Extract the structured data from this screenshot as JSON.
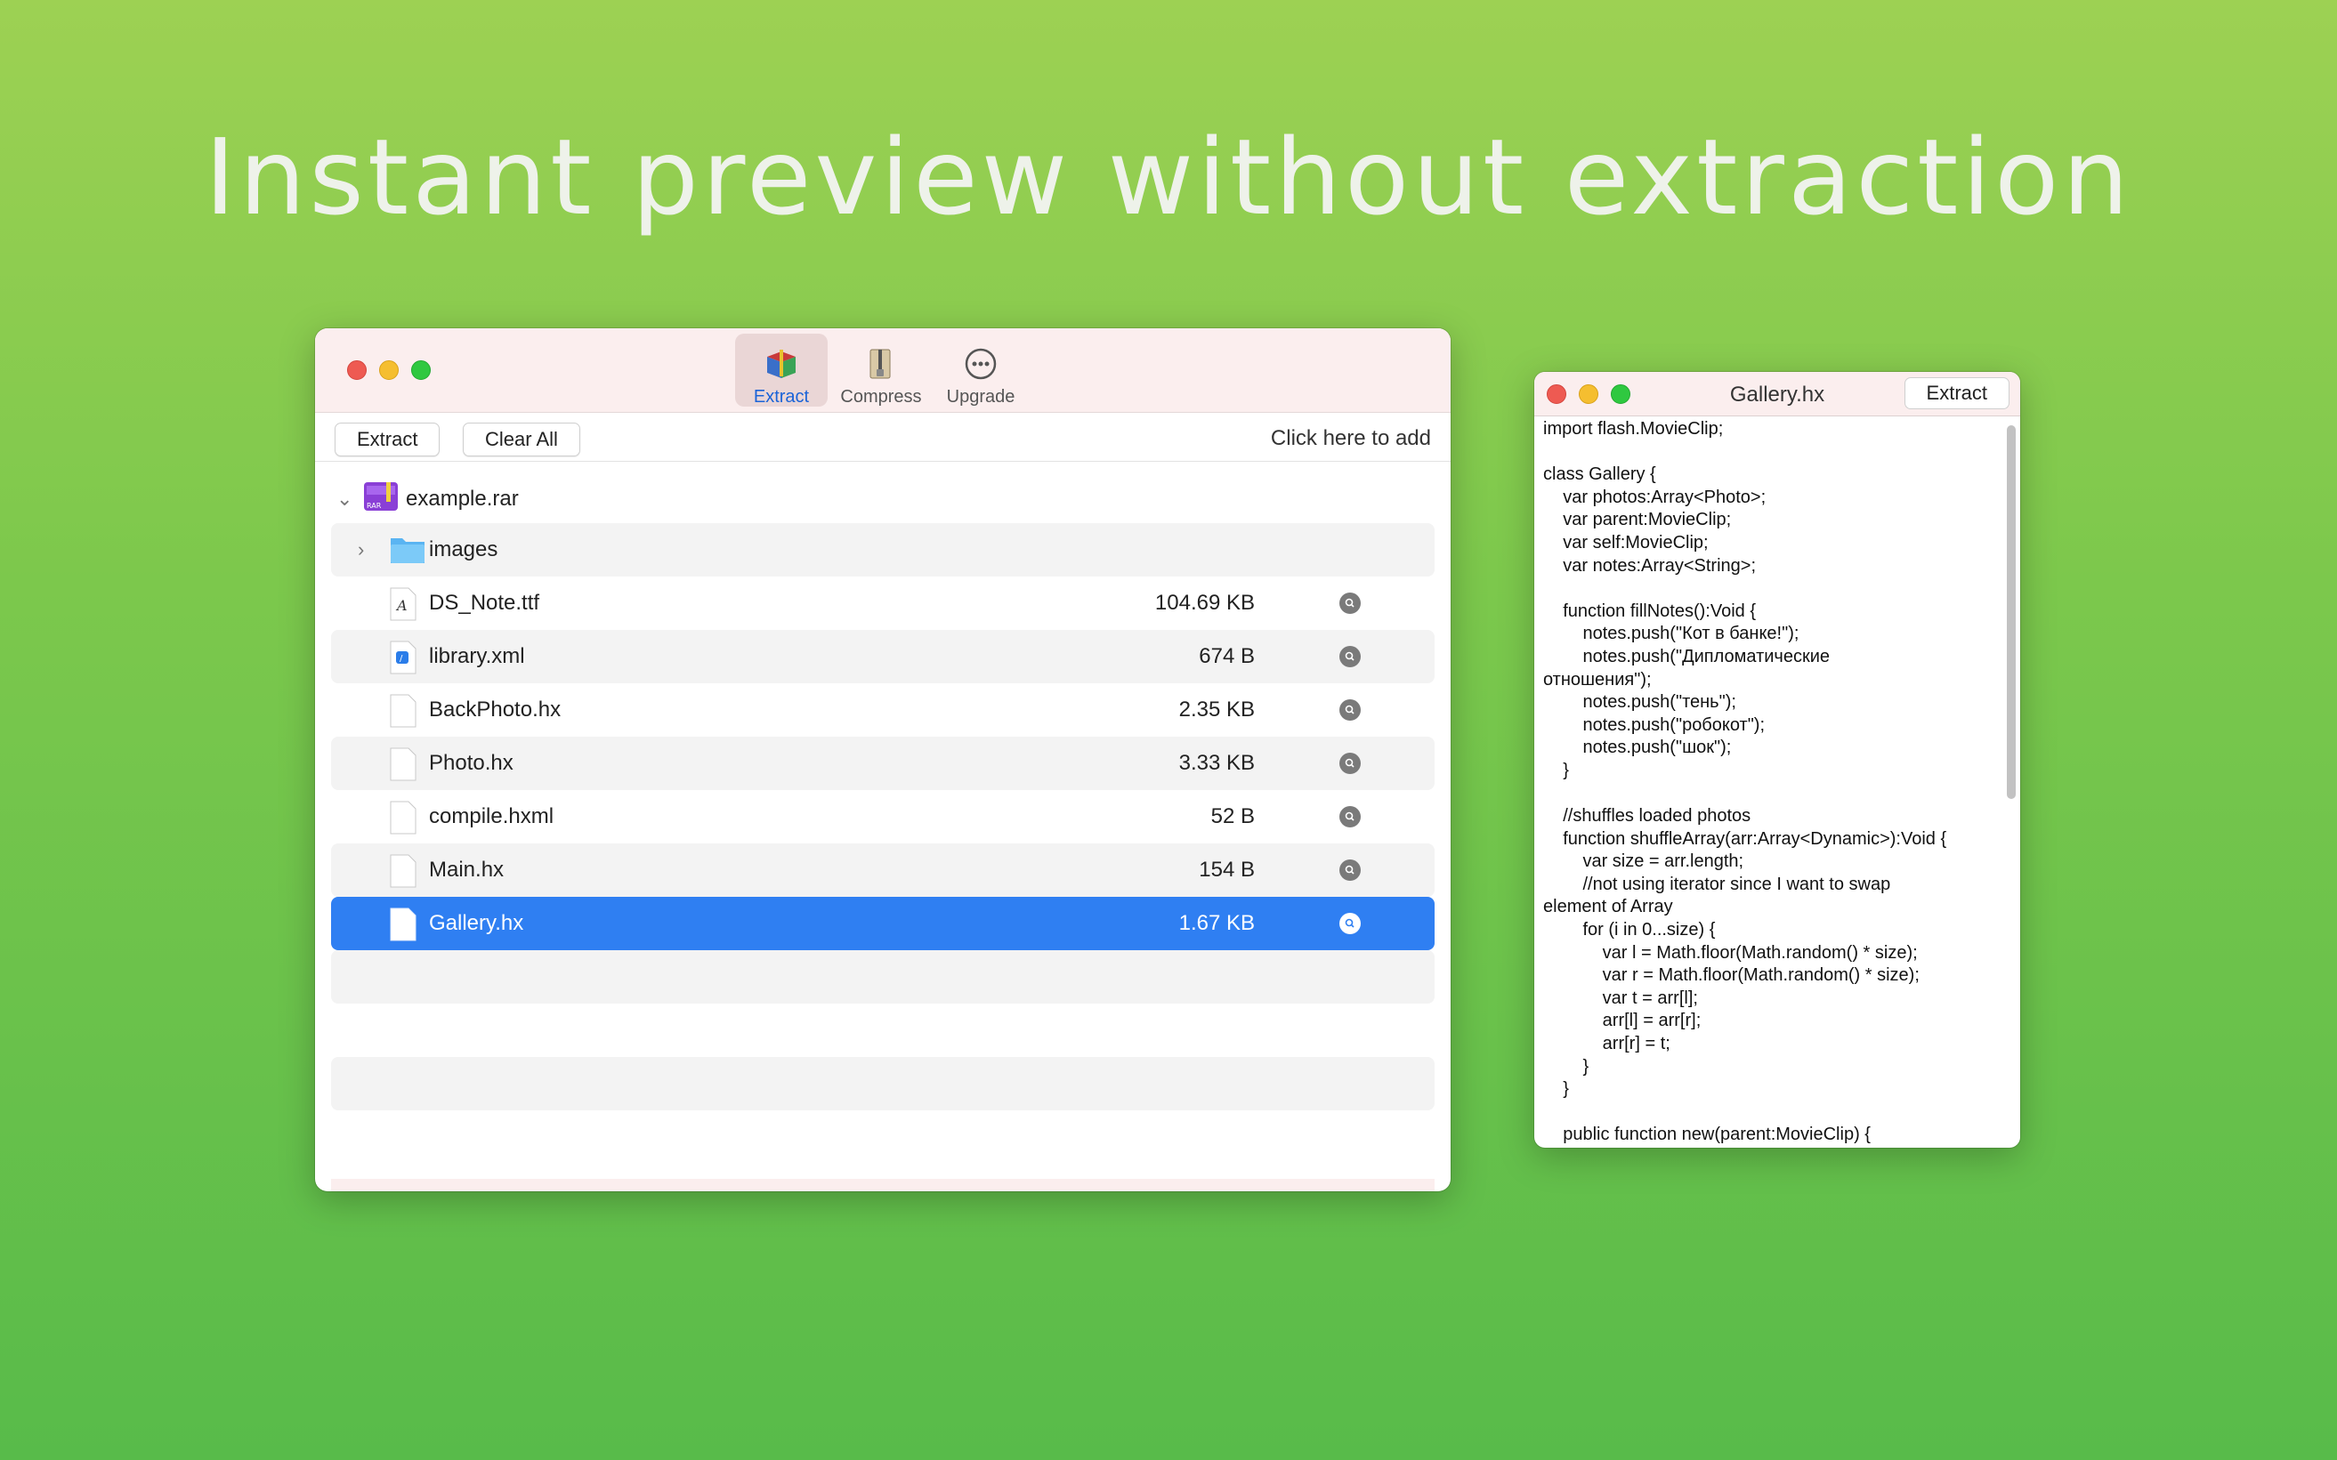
{
  "headline": "Instant preview without extraction",
  "main_window": {
    "toolbar": [
      {
        "label": "Extract",
        "icon": "winrar-books-icon",
        "active": true
      },
      {
        "label": "Compress",
        "icon": "zip-archive-icon",
        "active": false
      },
      {
        "label": "Upgrade",
        "icon": "ellipsis-circle-icon",
        "active": false
      }
    ],
    "actions": {
      "extract": "Extract",
      "clear_all": "Clear All",
      "click_add": "Click here to add"
    },
    "archive": {
      "name": "example.rar",
      "icon_text": "RAR"
    },
    "rows": [
      {
        "name": "images",
        "size": "",
        "type": "folder"
      },
      {
        "name": "DS_Note.ttf",
        "size": "104.69 KB",
        "type": "font"
      },
      {
        "name": "library.xml",
        "size": "674 B",
        "type": "xml"
      },
      {
        "name": "BackPhoto.hx",
        "size": "2.35 KB",
        "type": "file"
      },
      {
        "name": "Photo.hx",
        "size": "3.33 KB",
        "type": "file"
      },
      {
        "name": "compile.hxml",
        "size": "52 B",
        "type": "file"
      },
      {
        "name": "Main.hx",
        "size": "154 B",
        "type": "file"
      },
      {
        "name": "Gallery.hx",
        "size": "1.67 KB",
        "type": "file",
        "selected": true
      }
    ]
  },
  "preview_window": {
    "title": "Gallery.hx",
    "extract_label": "Extract",
    "code": "import flash.MovieClip;\n\nclass Gallery {\n    var photos:Array<Photo>;\n    var parent:MovieClip;\n    var self:MovieClip;\n    var notes:Array<String>;\n\n    function fillNotes():Void {\n        notes.push(\"Кот в банке!\");\n        notes.push(\"Дипломатические\nотношения\");\n        notes.push(\"тень\");\n        notes.push(\"робокот\");\n        notes.push(\"шок\");\n    }\n\n    //shuffles loaded photos\n    function shuffleArray(arr:Array<Dynamic>):Void {\n        var size = arr.length;\n        //not using iterator since I want to swap\nelement of Array\n        for (i in 0...size) {\n            var l = Math.floor(Math.random() * size);\n            var r = Math.floor(Math.random() * size);\n            var t = arr[l];\n            arr[l] = arr[r];\n            arr[r] = t;\n        }\n    }\n\n    public function new(parent:MovieClip) {"
  },
  "colors": {
    "background_top": "#9dd153",
    "background_bottom": "#58bb4a",
    "selection": "#2f7ff2",
    "titlebar": "#fbeeee"
  }
}
